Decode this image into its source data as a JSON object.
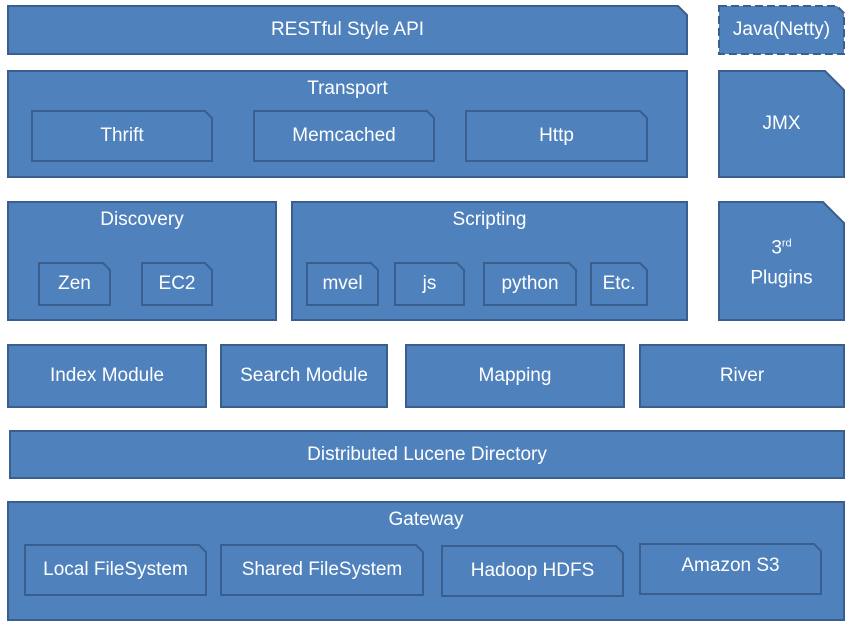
{
  "colors": {
    "fill": "#4f81bd",
    "stroke": "#3a5f8e",
    "text": "#ffffff",
    "background": "#ffffff"
  },
  "layers": {
    "restful_api": {
      "label": "RESTful Style API"
    },
    "java_netty": {
      "label": "Java(Netty)"
    },
    "transport": {
      "title": "Transport",
      "items": [
        "Thrift",
        "Memcached",
        "Http"
      ]
    },
    "jmx": {
      "label": "JMX"
    },
    "discovery": {
      "title": "Discovery",
      "items": [
        "Zen",
        "EC2"
      ]
    },
    "scripting": {
      "title": "Scripting",
      "items": [
        "mvel",
        "js",
        "python",
        "Etc."
      ]
    },
    "plugins": {
      "label_sup_base": "3",
      "label_sup": "rd",
      "label_line2": "Plugins"
    },
    "modules": [
      "Index Module",
      "Search Module",
      "Mapping",
      "River"
    ],
    "lucene": {
      "label": "Distributed Lucene Directory"
    },
    "gateway": {
      "title": "Gateway",
      "items": [
        "Local FileSystem",
        "Shared FileSystem",
        "Hadoop HDFS",
        "Amazon S3"
      ]
    }
  }
}
